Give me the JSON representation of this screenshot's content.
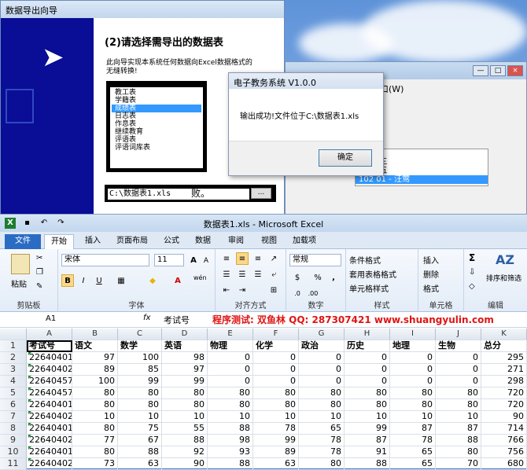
{
  "wizard": {
    "title": "数据导出向导",
    "heading": "(2)请选择需导出的数据表",
    "description": "此向导实现本系统任何数据向Excel数据格式的无缝转换!",
    "tables": [
      "教工表",
      "学籍表",
      "成绩表",
      "日志表",
      "作息表",
      "继续教育",
      "评语表",
      "评语词库表"
    ],
    "selected_index": 2,
    "path_value": "C:\\数据表1.xls",
    "browse_label": "...",
    "trailing_text": "败。"
  },
  "bg_window": {
    "menu_fragment": "口(W)",
    "list_items": [
      "号 姓名",
      "1 - 张三",
      "2 - 王五",
      "102  01 - 汪莺"
    ],
    "selected_index": 3,
    "btn_min": "—",
    "btn_max": "□",
    "btn_close": "×"
  },
  "msgbox": {
    "title": "电子教务系统 V1.0.0",
    "message": "输出成功!文件位于C:\\数据表1.xls",
    "ok_label": "确定"
  },
  "excel": {
    "title": "数据表1.xls - Microsoft Excel",
    "tabs": [
      "文件",
      "开始",
      "插入",
      "页面布局",
      "公式",
      "数据",
      "审阅",
      "视图",
      "加载项"
    ],
    "active_tab": 1,
    "ribbon": {
      "clipboard_label": "剪贴板",
      "paste_label": "粘贴",
      "font_label": "字体",
      "font_name": "宋体",
      "font_size": "11",
      "bold": "B",
      "italic": "I",
      "underline": "U",
      "grow_font": "A",
      "shrink_font": "A",
      "wen_label": "wén",
      "align_label": "对齐方式",
      "number_label": "数字",
      "number_format": "常规",
      "currency": "$",
      "percent": "%",
      "comma": ",",
      "styles_label": "样式",
      "cond_format": "条件格式",
      "table_format": "套用表格格式",
      "cell_styles": "单元格样式",
      "cells_label": "单元格",
      "insert": "插入",
      "delete": "删除",
      "format": "格式",
      "sigma": "Σ",
      "sort_filter": "排序和筛选",
      "edit_label": "编辑"
    },
    "name_box": "A1",
    "fx": "fx",
    "formula_content": "考试号",
    "promo": "程序测试: 双鱼林  QQ: 287307421  www.shuangyulin.com",
    "columns": [
      "A",
      "B",
      "C",
      "D",
      "E",
      "F",
      "G",
      "H",
      "I",
      "J",
      "K"
    ],
    "header_row": [
      "考试号",
      "语文",
      "数学",
      "英语",
      "物理",
      "化学",
      "政治",
      "历史",
      "地理",
      "生物",
      "总分"
    ],
    "rows": [
      [
        "22640401",
        "97",
        "100",
        "98",
        "0",
        "0",
        "0",
        "0",
        "0",
        "0",
        "295"
      ],
      [
        "22640402",
        "89",
        "85",
        "97",
        "0",
        "0",
        "0",
        "0",
        "0",
        "0",
        "271"
      ],
      [
        "22640457",
        "100",
        "99",
        "99",
        "0",
        "0",
        "0",
        "0",
        "0",
        "0",
        "298"
      ],
      [
        "22640457",
        "80",
        "80",
        "80",
        "80",
        "80",
        "80",
        "80",
        "80",
        "80",
        "720"
      ],
      [
        "22640401",
        "80",
        "80",
        "80",
        "80",
        "80",
        "80",
        "80",
        "80",
        "80",
        "720"
      ],
      [
        "22640402",
        "10",
        "10",
        "10",
        "10",
        "10",
        "10",
        "10",
        "10",
        "10",
        "90"
      ],
      [
        "22640401",
        "80",
        "75",
        "55",
        "88",
        "78",
        "65",
        "99",
        "87",
        "87",
        "714"
      ],
      [
        "22640402",
        "77",
        "67",
        "88",
        "98",
        "99",
        "78",
        "87",
        "78",
        "88",
        "766"
      ],
      [
        "22640401",
        "80",
        "88",
        "92",
        "93",
        "89",
        "78",
        "91",
        "65",
        "80",
        "756"
      ],
      [
        "22640402",
        "73",
        "63",
        "90",
        "88",
        "63",
        "80",
        "88",
        "65",
        "70",
        "680"
      ]
    ]
  }
}
